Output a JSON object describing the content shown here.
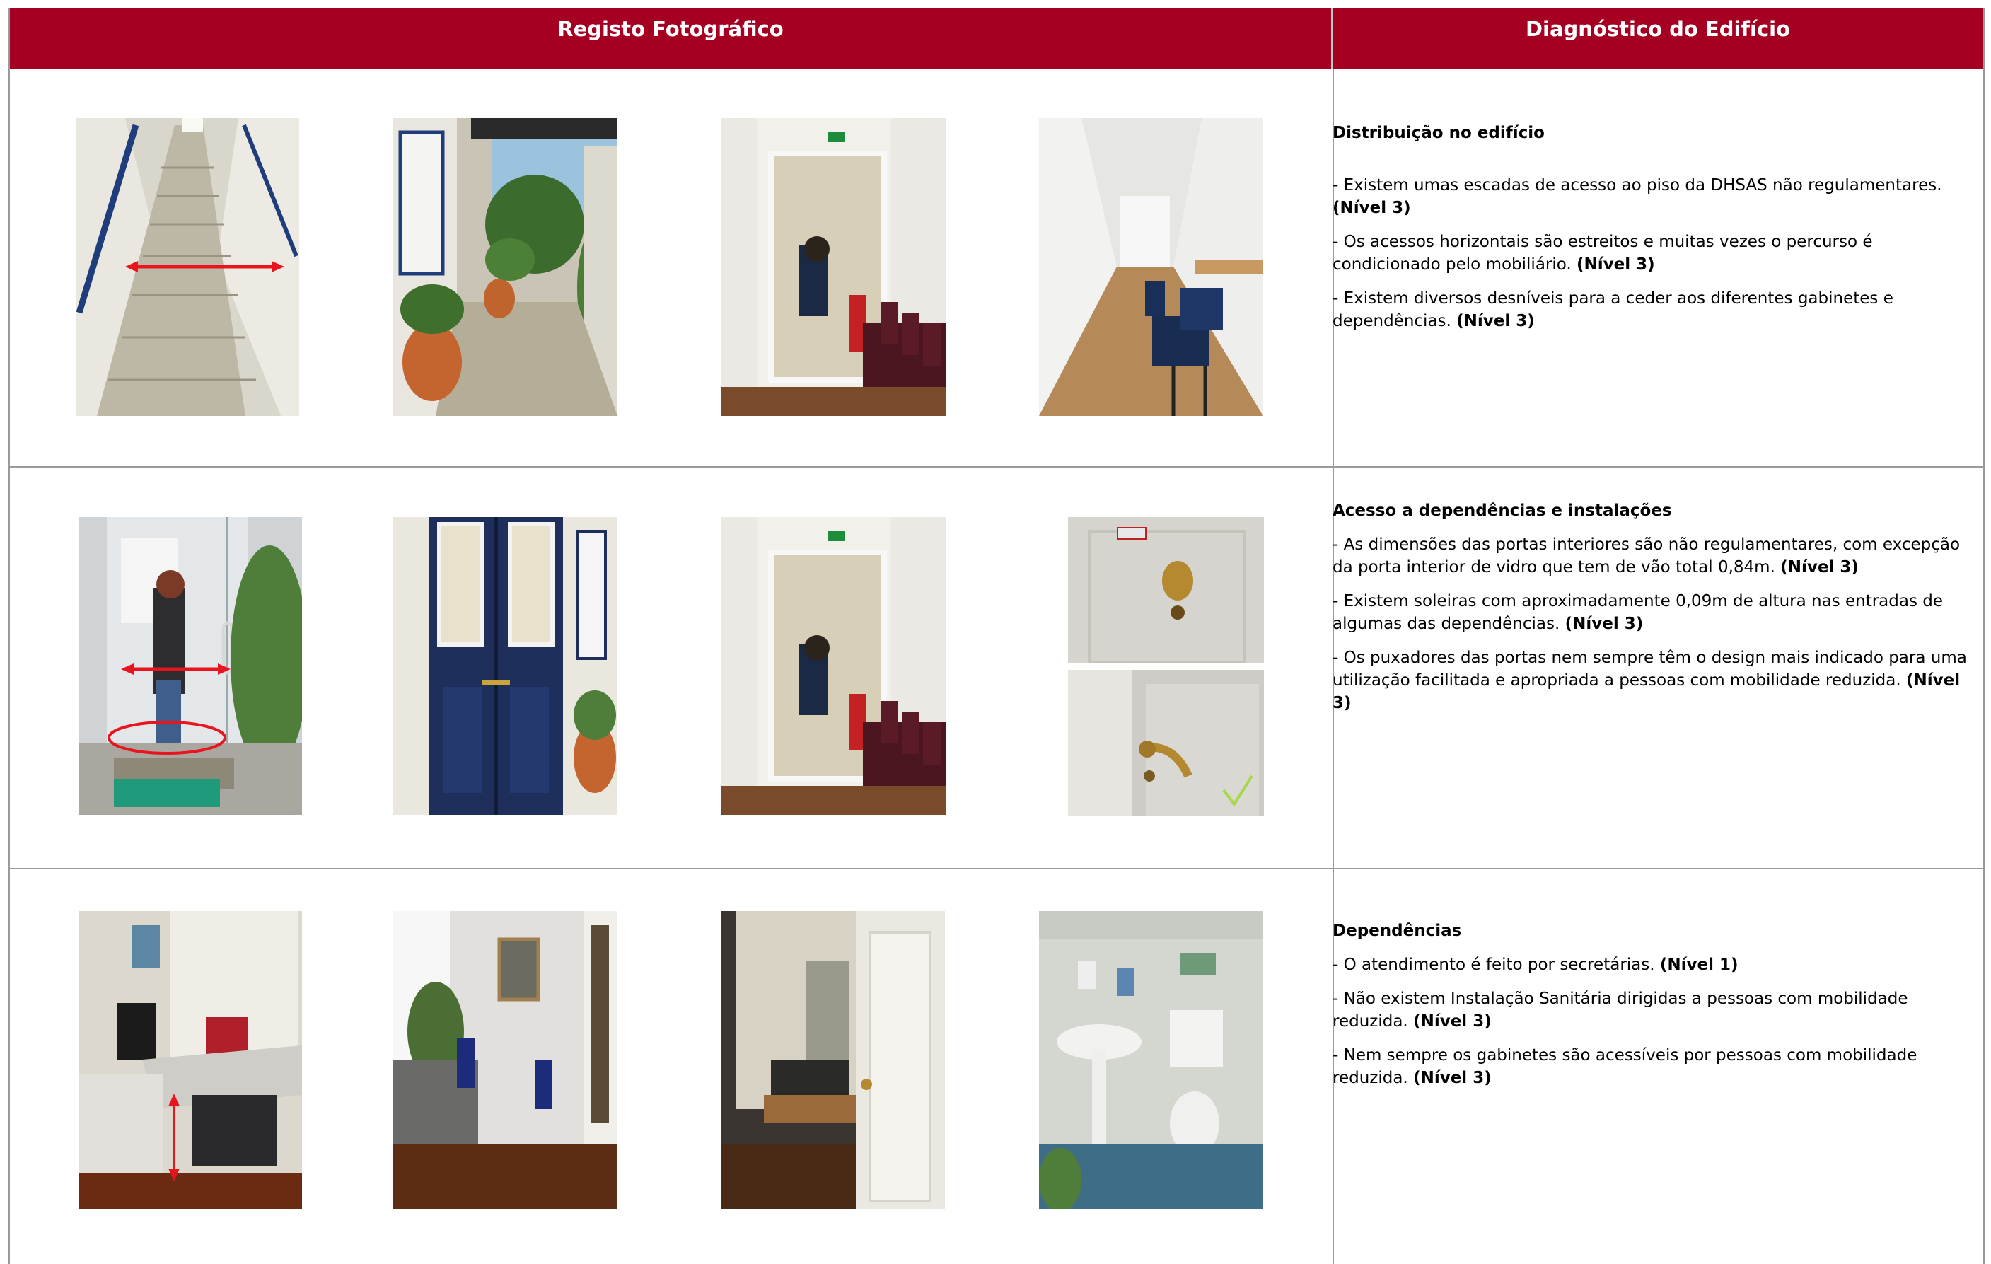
{
  "header": {
    "left_title": "Registo Fotográfico",
    "right_title": "Diagnóstico do Edifício"
  },
  "sections": [
    {
      "title": "Distribuição no edifício",
      "items": [
        {
          "text": "- Existem umas escadas de acesso ao piso da DHSAS não regulamentares.",
          "level": "(Nível 3)"
        },
        {
          "text": "- Os acessos horizontais são estreitos e muitas vezes o percurso é condicionado pelo mobiliário.",
          "level": "(Nível 3)"
        },
        {
          "text": "- Existem diversos desníveis para a ceder aos diferentes gabinetes e dependências.",
          "level": "(Nível 3)"
        }
      ]
    },
    {
      "title": "Acesso a dependências e instalações",
      "items": [
        {
          "text": "- As dimensões das portas interiores são não regulamentares, com excepção da porta interior de vidro que tem de vão total 0,84m.",
          "level": "(Nível 3)"
        },
        {
          "text": "- Existem soleiras com aproximadamente 0,09m de altura nas entradas de algumas das dependências. ",
          "level": "(Nível 3)"
        },
        {
          "text": "- Os puxadores das portas nem sempre têm o design mais indicado para uma utilização facilitada e apropriada a pessoas com mobilidade reduzida.",
          "level": "(Nível 3)"
        }
      ]
    },
    {
      "title": "Dependências",
      "items": [
        {
          "text": "- O atendimento é feito por secretárias.",
          "level": "(Nível 1)"
        },
        {
          "text": "- Não existem Instalação Sanitária dirigidas a pessoas com mobilidade reduzida.",
          "level": "(Nível 3)"
        },
        {
          "text": "- Nem sempre os gabinetes são acessíveis por pessoas com mobilidade reduzida.",
          "level": "(Nível 3)"
        }
      ]
    }
  ],
  "colors": {
    "header_bg": "#a50021",
    "header_text": "#ffffff",
    "annotation_red": "#e8141e",
    "checkmark_green": "#a6d84a"
  }
}
